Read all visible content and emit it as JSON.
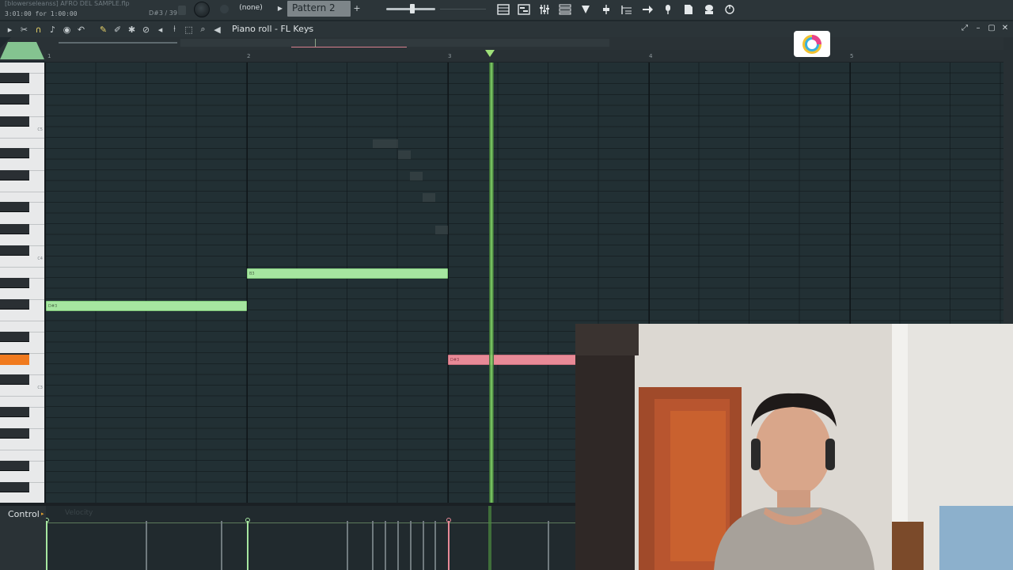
{
  "topbar": {
    "project_title": "[blowerseleanss] AFRO DEL SAMPLE.flp",
    "time_text": "3:01:00 for 1:00:00",
    "hint_text": "D#3 / 39",
    "channel_none": "(none)",
    "pattern_name": "Pattern 2",
    "icons": [
      "playlist-icon",
      "piano-roll-icon",
      "mixer-icon",
      "channel-rack-icon",
      "plugin-picker-icon",
      "step-sequencer-icon",
      "browser-icon",
      "arrow-icon",
      "microphone-icon",
      "file-icon",
      "render-icon",
      "refresh-icon"
    ]
  },
  "piano_roll": {
    "title": "Piano roll - FL Keys",
    "window_buttons": [
      "⤢",
      "–",
      "▢",
      "✕"
    ]
  },
  "ruler": {
    "bars": [
      "1",
      "2",
      "3",
      "4",
      "5"
    ]
  },
  "keyboard": {
    "octave_labels": [
      "C5",
      "C4",
      "C3"
    ],
    "highlighted_key": "D#3",
    "highlight_color": "#f07a1e"
  },
  "notes": [
    {
      "label": "D#3",
      "color": "green"
    },
    {
      "label": "B3",
      "color": "green"
    },
    {
      "label": "D#3",
      "color": "pink"
    }
  ],
  "control": {
    "label": "Control",
    "ghost_label": "Velocity"
  },
  "colors": {
    "note_green": "#a6e6a0",
    "note_pink": "#e88a97",
    "playhead": "#8de66e",
    "accent_orange": "#f07a1e"
  }
}
